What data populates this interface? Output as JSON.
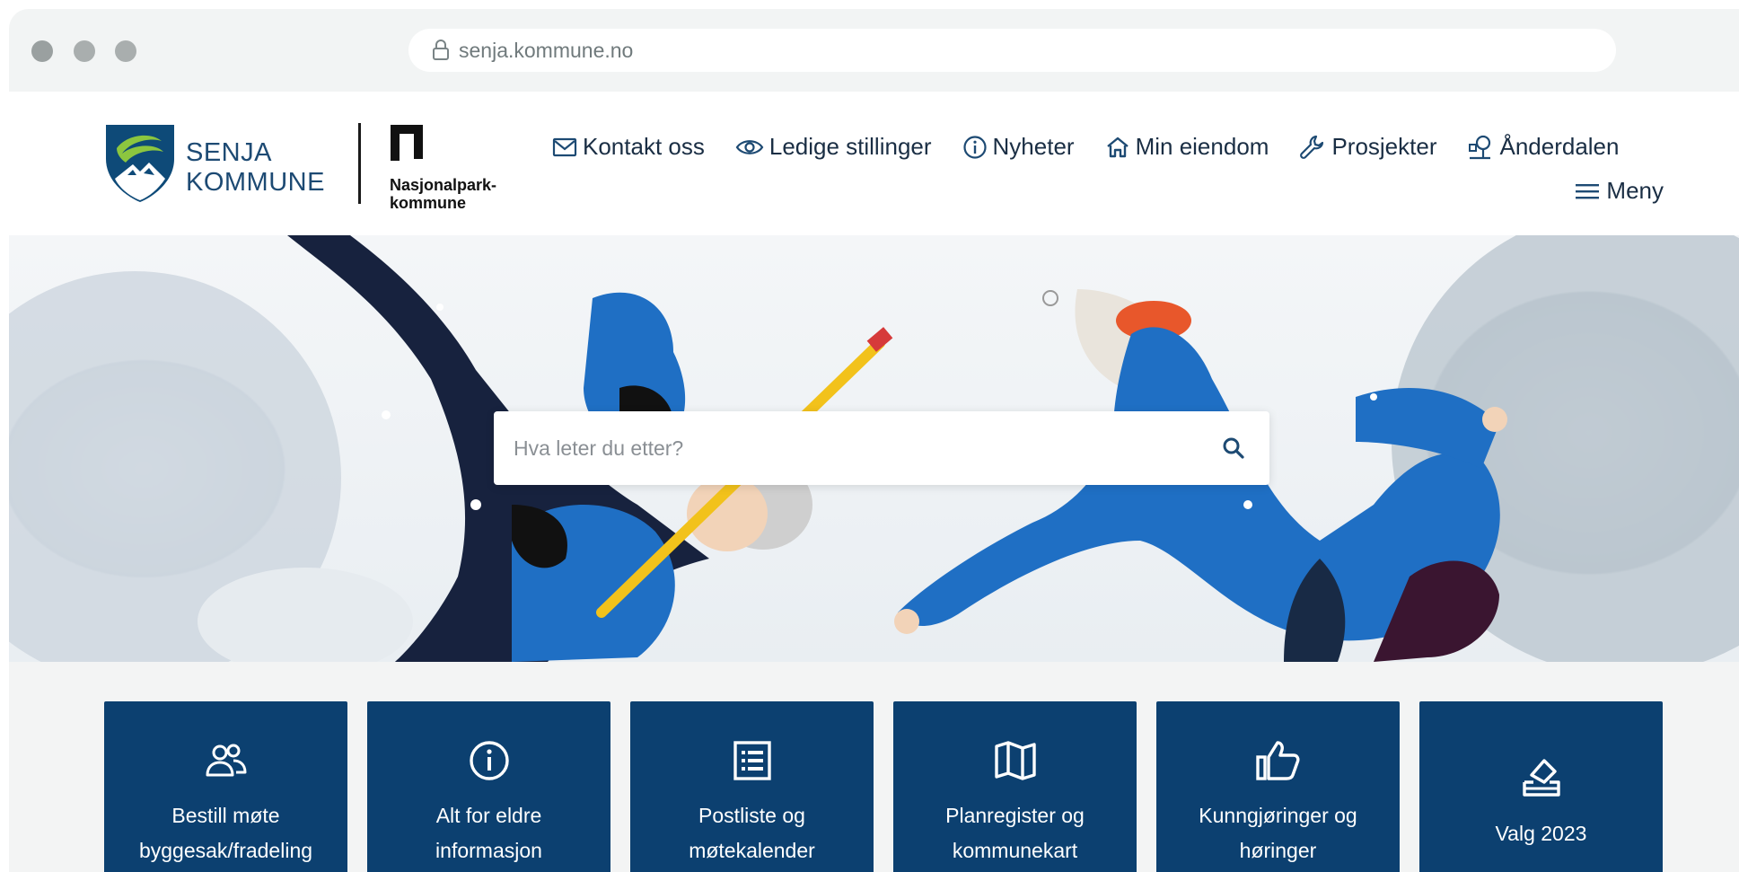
{
  "browser": {
    "url": "senja.kommune.no",
    "icons": {
      "lock": "lock-icon"
    }
  },
  "header": {
    "logo_line1": "SENJA",
    "logo_line2": "KOMMUNE",
    "np_line1": "Nasjonalpark-",
    "np_line2": "kommune",
    "nav": [
      {
        "label": "Kontakt oss",
        "icon": "mail-icon"
      },
      {
        "label": "Ledige stillinger",
        "icon": "eye-icon"
      },
      {
        "label": "Nyheter",
        "icon": "info-icon"
      },
      {
        "label": "Min eiendom",
        "icon": "home-icon"
      },
      {
        "label": "Prosjekter",
        "icon": "wrench-icon"
      },
      {
        "label": "Ånderdalen",
        "icon": "viewpoint-icon"
      }
    ],
    "menu_label": "Meny",
    "menu_icon": "hamburger-icon"
  },
  "hero": {
    "search_placeholder": "Hva leter du etter?",
    "search_icon": "search-icon"
  },
  "tiles": [
    {
      "line1": "Bestill møte",
      "line2": "byggesak/fradeling",
      "icon": "users-icon"
    },
    {
      "line1": "Alt for eldre",
      "line2": "informasjon",
      "icon": "info-icon"
    },
    {
      "line1": "Postliste og",
      "line2": "møtekalender",
      "icon": "list-icon"
    },
    {
      "line1": "Planregister og",
      "line2": "kommunekart",
      "icon": "map-icon"
    },
    {
      "line1": "Kunngjøringer og",
      "line2": "høringer",
      "icon": "thumbs-up-icon"
    },
    {
      "line1": "Valg 2023",
      "line2": "",
      "icon": "ballot-icon"
    }
  ],
  "colors": {
    "brand_navy": "#0c4070",
    "nav_text": "#1a2e44",
    "logo_green": "#8cc63f"
  }
}
